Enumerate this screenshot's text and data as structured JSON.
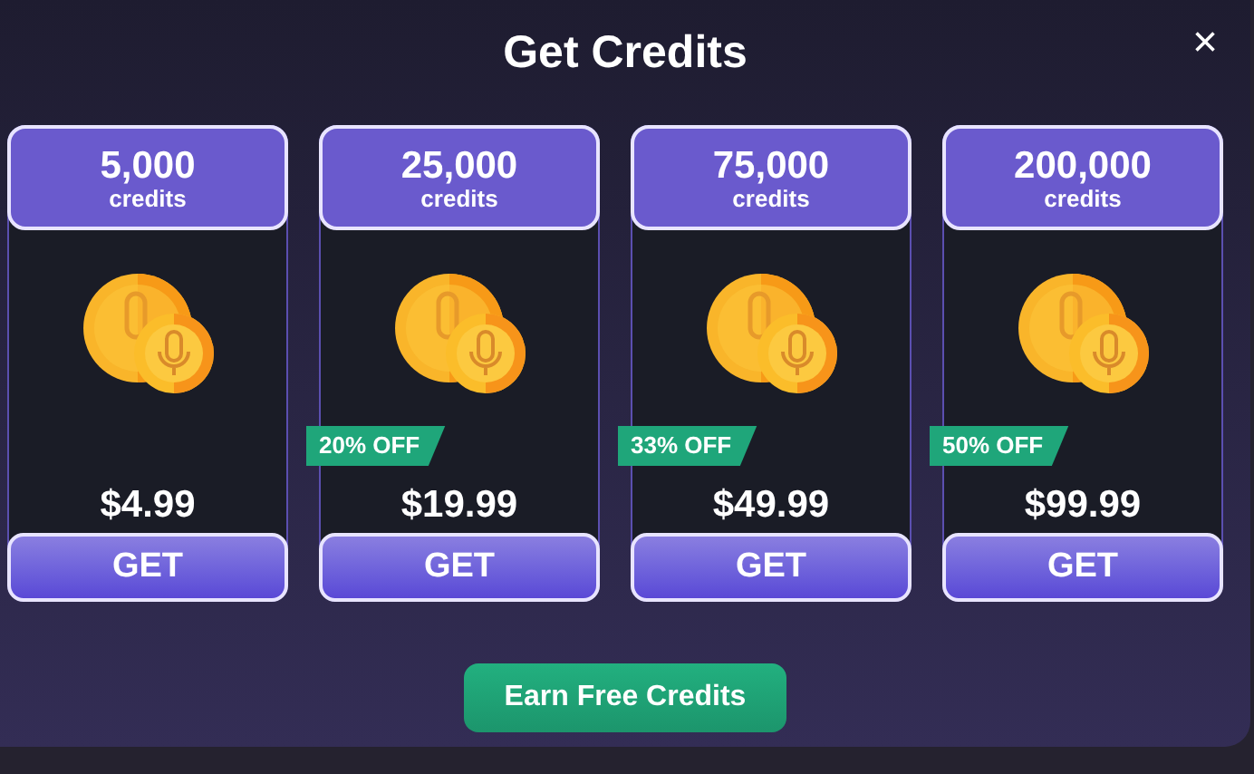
{
  "title": "Get Credits",
  "close": "×",
  "packages": [
    {
      "amount": "5,000",
      "unit": "credits",
      "price": "$4.99",
      "button": "GET"
    },
    {
      "amount": "25,000",
      "unit": "credits",
      "discount": "20% OFF",
      "price": "$19.99",
      "button": "GET"
    },
    {
      "amount": "75,000",
      "unit": "credits",
      "discount": "33% OFF",
      "price": "$49.99",
      "button": "GET"
    },
    {
      "amount": "200,000",
      "unit": "credits",
      "discount": "50% OFF",
      "price": "$99.99",
      "button": "GET"
    }
  ],
  "earn_button": "Earn Free Credits"
}
